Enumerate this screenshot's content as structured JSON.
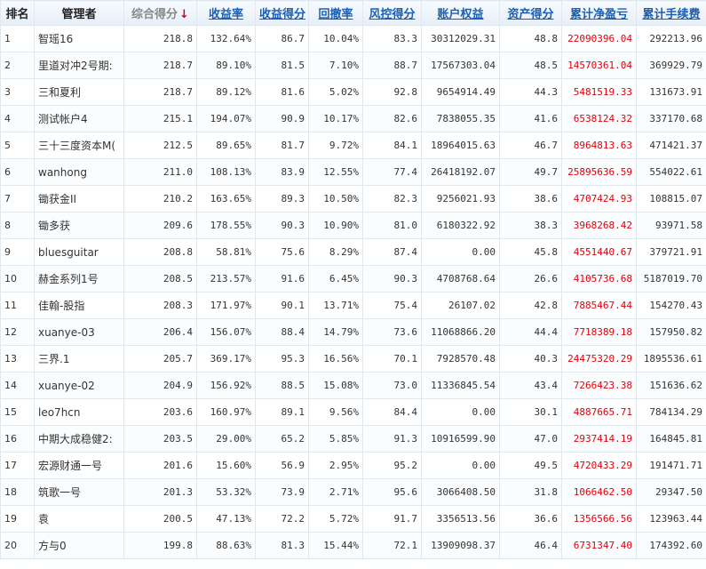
{
  "headers": [
    "排名",
    "管理者",
    "综合得分",
    "收益率",
    "收益得分",
    "回撤率",
    "风控得分",
    "账户权益",
    "资产得分",
    "累计净盈亏",
    "累计手续费"
  ],
  "sort_arrow": "↓",
  "rows": [
    [
      "1",
      "智瑶16",
      "218.8",
      "132.64%",
      "86.7",
      "10.04%",
      "83.3",
      "30312029.31",
      "48.8",
      "22090396.04",
      "292213.96"
    ],
    [
      "2",
      "里道对冲2号期:",
      "218.7",
      "89.10%",
      "81.5",
      "7.10%",
      "88.7",
      "17567303.04",
      "48.5",
      "14570361.04",
      "369929.79"
    ],
    [
      "3",
      "三和夏利",
      "218.7",
      "89.12%",
      "81.6",
      "5.02%",
      "92.8",
      "9654914.49",
      "44.3",
      "5481519.33",
      "131673.91"
    ],
    [
      "4",
      "测试帐户4",
      "215.1",
      "194.07%",
      "90.9",
      "10.17%",
      "82.6",
      "7838055.35",
      "41.6",
      "6538124.32",
      "337170.68"
    ],
    [
      "5",
      "三十三度资本M(",
      "212.5",
      "89.65%",
      "81.7",
      "9.72%",
      "84.1",
      "18964015.63",
      "46.7",
      "8964813.63",
      "471421.37"
    ],
    [
      "6",
      "wanhong",
      "211.0",
      "108.13%",
      "83.9",
      "12.55%",
      "77.4",
      "26418192.07",
      "49.7",
      "25895636.59",
      "554022.61"
    ],
    [
      "7",
      "锄获金II",
      "210.2",
      "163.65%",
      "89.3",
      "10.50%",
      "82.3",
      "9256021.93",
      "38.6",
      "4707424.93",
      "108815.07"
    ],
    [
      "8",
      "锄多获",
      "209.6",
      "178.55%",
      "90.3",
      "10.90%",
      "81.0",
      "6180322.92",
      "38.3",
      "3968268.42",
      "93971.58"
    ],
    [
      "9",
      "bluesguitar",
      "208.8",
      "58.81%",
      "75.6",
      "8.29%",
      "87.4",
      "0.00",
      "45.8",
      "4551440.67",
      "379721.91"
    ],
    [
      "10",
      "赫金系列1号",
      "208.5",
      "213.57%",
      "91.6",
      "6.45%",
      "90.3",
      "4708768.64",
      "26.6",
      "4105736.68",
      "5187019.70"
    ],
    [
      "11",
      "佳翰-股指",
      "208.3",
      "171.97%",
      "90.1",
      "13.71%",
      "75.4",
      "26107.02",
      "42.8",
      "7885467.44",
      "154270.43"
    ],
    [
      "12",
      "xuanye-03",
      "206.4",
      "156.07%",
      "88.4",
      "14.79%",
      "73.6",
      "11068866.20",
      "44.4",
      "7718389.18",
      "157950.82"
    ],
    [
      "13",
      "三界.1",
      "205.7",
      "369.17%",
      "95.3",
      "16.56%",
      "70.1",
      "7928570.48",
      "40.3",
      "24475320.29",
      "1895536.61"
    ],
    [
      "14",
      "xuanye-02",
      "204.9",
      "156.92%",
      "88.5",
      "15.08%",
      "73.0",
      "11336845.54",
      "43.4",
      "7266423.38",
      "151636.62"
    ],
    [
      "15",
      "leo7hcn",
      "203.6",
      "160.97%",
      "89.1",
      "9.56%",
      "84.4",
      "0.00",
      "30.1",
      "4887665.71",
      "784134.29"
    ],
    [
      "16",
      "中期大成稳健2:",
      "203.5",
      "29.00%",
      "65.2",
      "5.85%",
      "91.3",
      "10916599.90",
      "47.0",
      "2937414.19",
      "164845.81"
    ],
    [
      "17",
      "宏源财通一号",
      "201.6",
      "15.60%",
      "56.9",
      "2.95%",
      "95.2",
      "0.00",
      "49.5",
      "4720433.29",
      "191471.71"
    ],
    [
      "18",
      "筑歌一号",
      "201.3",
      "53.32%",
      "73.9",
      "2.71%",
      "95.6",
      "3066408.50",
      "31.8",
      "1066462.50",
      "29347.50"
    ],
    [
      "19",
      "袁",
      "200.5",
      "47.13%",
      "72.2",
      "5.72%",
      "91.7",
      "3356513.56",
      "36.6",
      "1356566.56",
      "123963.44"
    ],
    [
      "20",
      "方与0",
      "199.8",
      "88.63%",
      "81.3",
      "15.44%",
      "72.1",
      "13909098.37",
      "46.4",
      "6731347.40",
      "174392.60"
    ]
  ]
}
